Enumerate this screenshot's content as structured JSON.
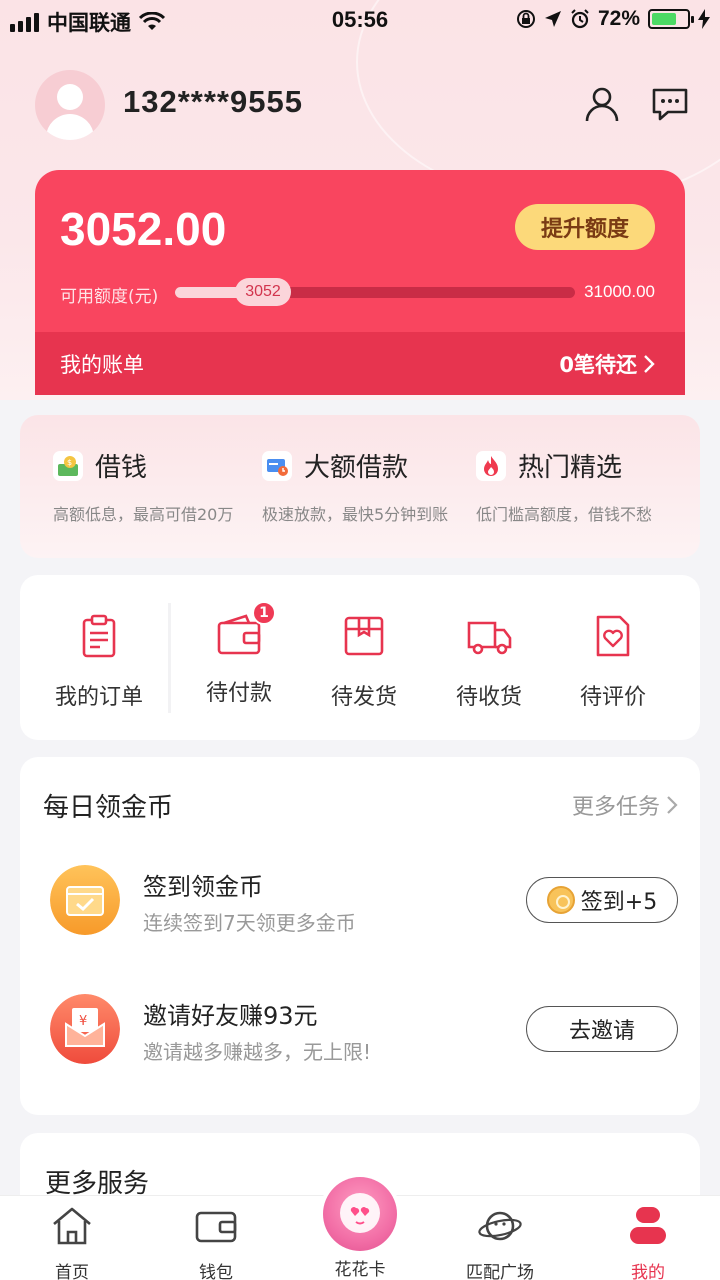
{
  "status_bar": {
    "carrier": "中国联通",
    "time": "05:56",
    "battery": "72%"
  },
  "profile": {
    "phone": "132****9555"
  },
  "credit": {
    "available_amount": "3052.00",
    "raise_button": "提升额度",
    "limit_label": "可用额度(元)",
    "current_label": "3052",
    "max_label": "31000.00",
    "progress_fraction": 0.22,
    "bill_label": "我的账单",
    "bill_status": "0笔待还"
  },
  "loans": [
    {
      "title": "借钱",
      "sub": "高额低息，最高可借20万",
      "icon": "money-bag-icon"
    },
    {
      "title": "大额借款",
      "sub": "极速放款，最快5分钟到账",
      "icon": "card-clock-icon"
    },
    {
      "title": "热门精选",
      "sub": "低门槛高额度，借钱不愁",
      "icon": "fire-icon"
    }
  ],
  "orders": {
    "items": [
      {
        "label": "我的订单",
        "icon": "clipboard-icon"
      },
      {
        "label": "待付款",
        "icon": "wallet-icon",
        "badge": "1"
      },
      {
        "label": "待发货",
        "icon": "package-icon"
      },
      {
        "label": "待收货",
        "icon": "truck-icon"
      },
      {
        "label": "待评价",
        "icon": "heart-note-icon"
      }
    ]
  },
  "coins": {
    "title": "每日领金币",
    "more": "更多任务",
    "tasks": [
      {
        "title": "签到领金币",
        "sub": "连续签到7天领更多金币",
        "button": "签到+5"
      },
      {
        "title": "邀请好友赚93元",
        "sub": "邀请越多赚越多，无上限!",
        "button": "去邀请"
      }
    ]
  },
  "more_services": {
    "title": "更多服务"
  },
  "tabs": [
    {
      "label": "首页",
      "icon": "home-icon"
    },
    {
      "label": "钱包",
      "icon": "wallet-icon"
    },
    {
      "label": "花花卡",
      "icon": "flower-card-icon"
    },
    {
      "label": "匹配广场",
      "icon": "planet-icon"
    },
    {
      "label": "我的",
      "icon": "user-icon"
    }
  ],
  "colors": {
    "accent": "#f9455f",
    "accent_dark": "#e7344f",
    "gold": "#fcd97a"
  }
}
